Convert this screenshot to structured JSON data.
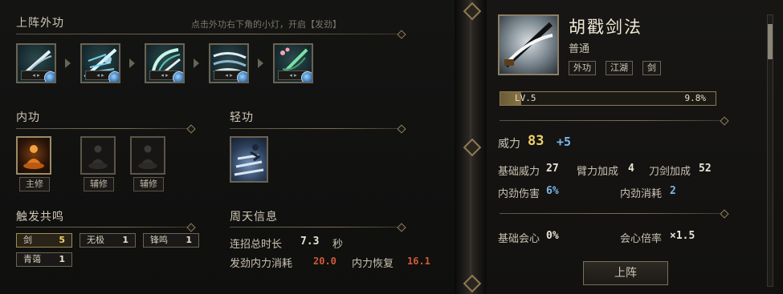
{
  "left": {
    "waigong": {
      "title": "上阵外功",
      "hint": "点击外功右下角的小灯，开启【发劲】",
      "skills": [
        {
          "icon": "blade-slash-icon"
        },
        {
          "icon": "sword-burst-icon"
        },
        {
          "icon": "crescent-slash-icon"
        },
        {
          "icon": "whirlwind-slash-icon"
        },
        {
          "icon": "blossom-sword-icon"
        }
      ]
    },
    "neigong": {
      "title": "内功",
      "slots": [
        {
          "label": "主修",
          "icon": "meditation-flame-icon"
        },
        {
          "label": "辅修",
          "icon": "meditation-icon"
        },
        {
          "label": "辅修",
          "icon": "meditation-icon"
        }
      ]
    },
    "qinggong": {
      "title": "轻功",
      "icon": "running-steps-icon"
    },
    "resonance": {
      "title": "触发共鸣",
      "chips": [
        {
          "name": "剑",
          "count": "5"
        },
        {
          "name": "无极",
          "count": "1"
        },
        {
          "name": "锋鸣",
          "count": "1"
        },
        {
          "name": "青蔼",
          "count": "1"
        }
      ]
    },
    "zhoutian": {
      "title": "周天信息",
      "total_label": "连招总时长",
      "total_value": "7.3",
      "total_unit": "秒",
      "cost_label": "发劲内力消耗",
      "cost_value": "20.0",
      "recover_label": "内力恢复",
      "recover_value": "16.1"
    }
  },
  "right": {
    "skill_name": "胡戳剑法",
    "grade": "普通",
    "tags": [
      "外功",
      "江湖",
      "剑"
    ],
    "level": "LV.5",
    "level_percent": "9.8%",
    "level_fraction": 0.098,
    "power_label": "威力",
    "power_value": "83",
    "power_bonus": "+5",
    "stats": {
      "base_power_label": "基础威力",
      "base_power_value": "27",
      "arm_bonus_label": "臂力加成",
      "arm_bonus_value": "4",
      "blade_bonus_label": "刀剑加成",
      "blade_bonus_value": "52",
      "inner_dmg_label": "内劲伤害",
      "inner_dmg_value": "6%",
      "inner_cost_label": "内劲消耗",
      "inner_cost_value": "2",
      "base_crit_label": "基础会心",
      "base_crit_value": "0%",
      "crit_mult_label": "会心倍率",
      "crit_mult_value": "×1.5"
    },
    "equip_button": "上阵"
  },
  "colors": {
    "gold": "#f0cf6a",
    "blue": "#7ab8ea",
    "red": "#d25a3a",
    "frame": "#6b6355"
  }
}
